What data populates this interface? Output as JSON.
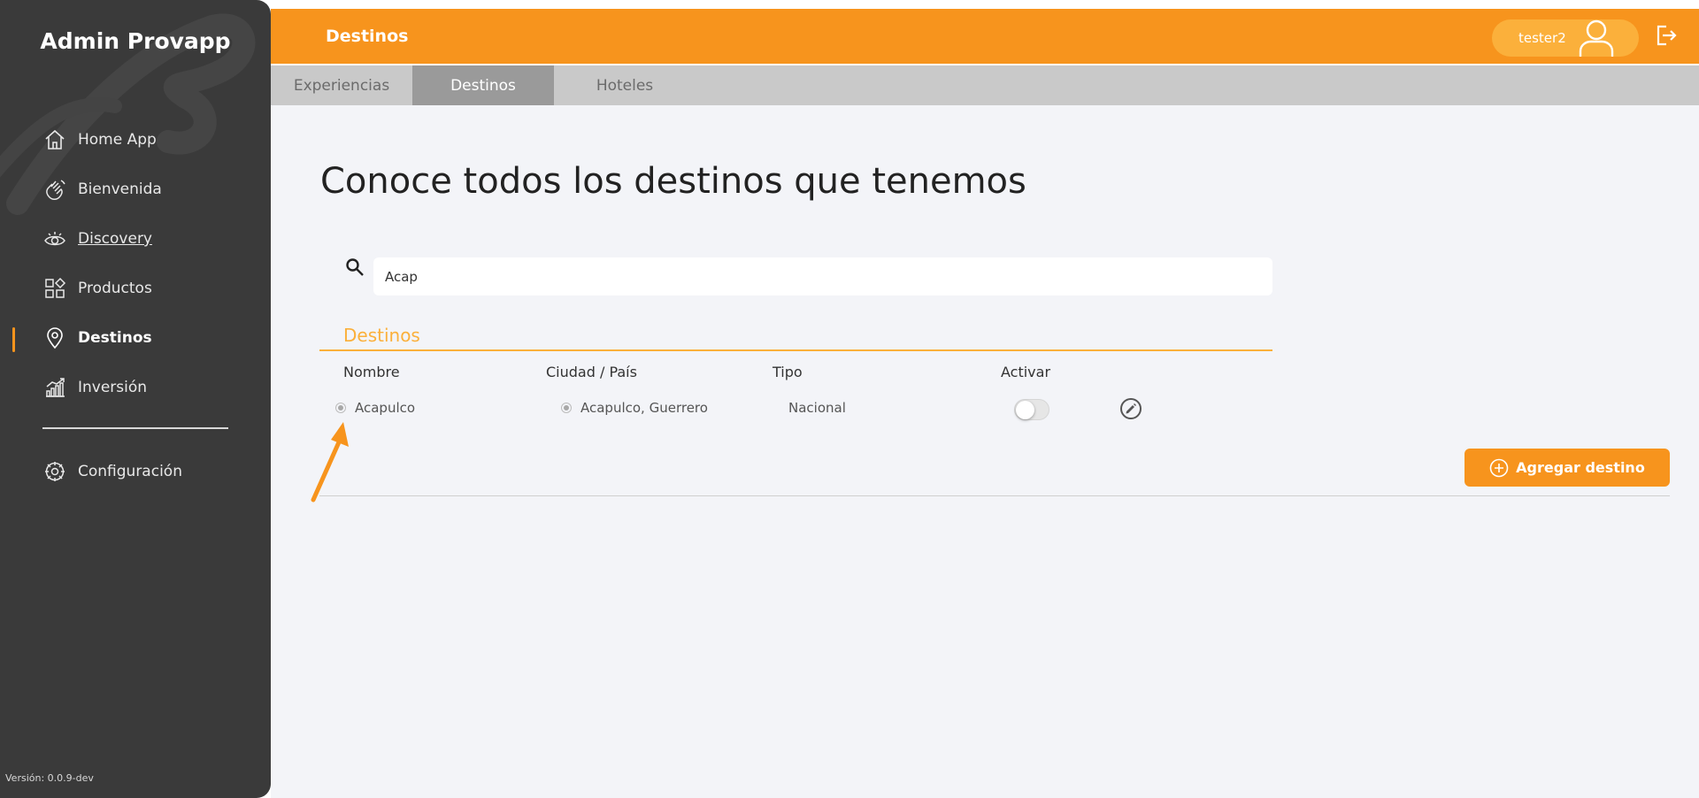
{
  "sidebar": {
    "brand": "Admin Provapp",
    "items": [
      {
        "label": "Home App",
        "icon": "home-icon"
      },
      {
        "label": "Bienvenida",
        "icon": "wave-hand-icon"
      },
      {
        "label": "Discovery",
        "icon": "eye-icon"
      },
      {
        "label": "Productos",
        "icon": "grid-icon"
      },
      {
        "label": "Destinos",
        "icon": "location-pin-icon",
        "active": true
      },
      {
        "label": "Inversión",
        "icon": "chart-icon"
      }
    ],
    "config_label": "Configuración",
    "version": "Versión: 0.0.9-dev"
  },
  "topbar": {
    "title": "Destinos",
    "username": "tester2",
    "logout_icon": "logout-icon"
  },
  "tabs": [
    {
      "label": "Experiencias",
      "active": false
    },
    {
      "label": "Destinos",
      "active": true
    },
    {
      "label": "Hoteles",
      "active": false
    }
  ],
  "main": {
    "heading": "Conoce todos los destinos que tenemos",
    "search_value": "Acap",
    "section_title": "Destinos",
    "columns": [
      "Nombre",
      "Ciudad / País",
      "Tipo",
      "Activar"
    ],
    "rows": [
      {
        "nombre": "Acapulco",
        "ciudad": "Acapulco, Guerrero",
        "tipo": "Nacional",
        "activo": false
      }
    ],
    "add_button": "Agregar destino"
  },
  "colors": {
    "accent": "#f7941d",
    "accent_light": "#fbb03b",
    "sidebar_bg": "#3a3a3a",
    "main_bg": "#f3f4f8",
    "tab_bar": "#c9c9c9",
    "tab_active": "#9a9a9a"
  }
}
